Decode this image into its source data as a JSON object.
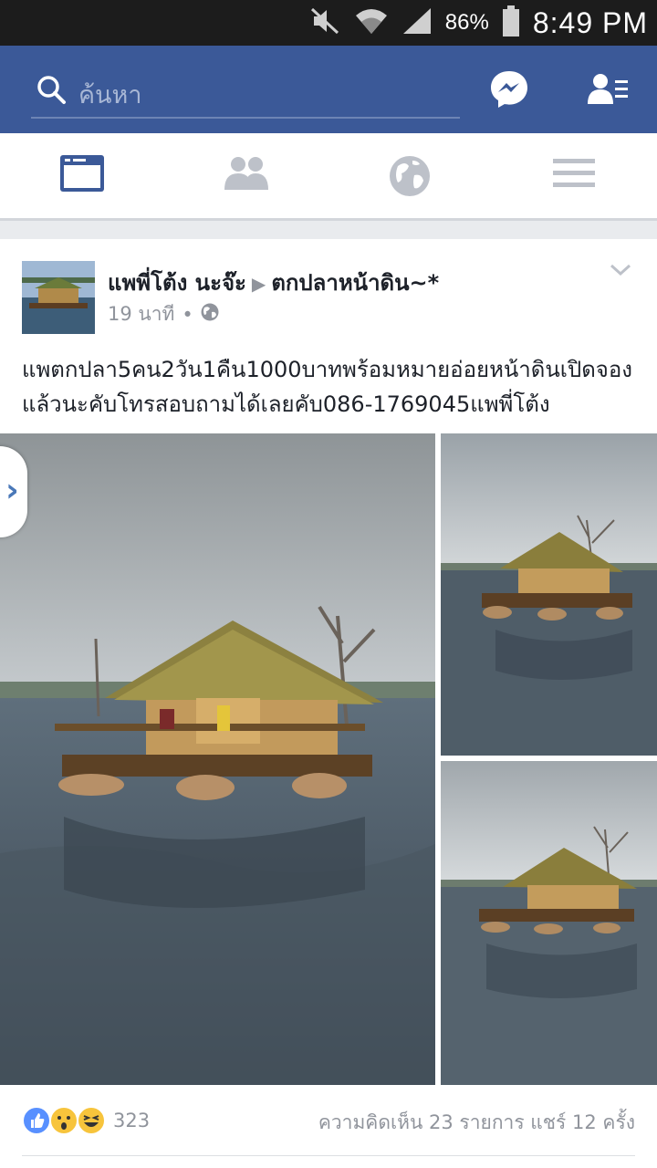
{
  "status_bar": {
    "battery_percent": "86%",
    "time": "8:49 PM",
    "icons": [
      "mute-icon",
      "wifi-icon",
      "signal-icon",
      "battery-icon"
    ]
  },
  "header": {
    "search_placeholder": "ค้นหา",
    "icons": [
      "search-icon",
      "messenger-icon",
      "friend-requests-icon"
    ]
  },
  "nav_tabs": [
    {
      "name": "news-feed",
      "icon": "news-feed-icon",
      "active": true
    },
    {
      "name": "friends",
      "icon": "friends-icon",
      "active": false
    },
    {
      "name": "notifications",
      "icon": "globe-icon",
      "active": false
    },
    {
      "name": "menu",
      "icon": "menu-icon",
      "active": false
    }
  ],
  "post": {
    "author": "แพพี่โต้ง นะจ๊ะ",
    "target": "ตกปลาหน้าดิน~*",
    "time": "19 นาที",
    "text": "แพตกปลา5คน2วัน1คืน1000บาทพร้อมหมายอ่อยหน้าดินเปิดจองแล้วนะคับโทรสอบถามได้เลยคับ086-1769045แพพี่โต้ง",
    "reaction_count": "323",
    "stats": "ความคิดเห็น 23 รายการ แชร์ 12 ครั้ง"
  },
  "colors": {
    "facebook_blue": "#3b5998",
    "status_bar": "#1c1c1c",
    "muted_text": "#90949c"
  }
}
